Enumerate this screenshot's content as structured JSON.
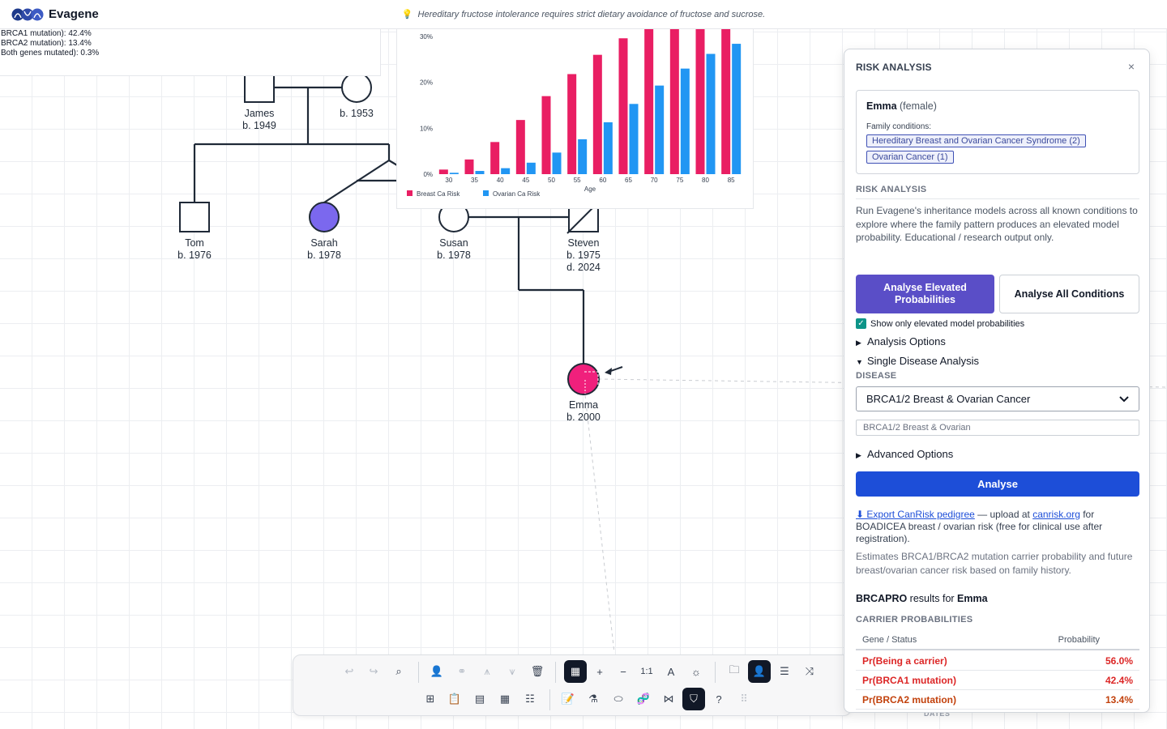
{
  "app": {
    "name": "Evagene",
    "tip": "Hereditary fructose intolerance requires strict dietary avoidance of fructose and sucrose.",
    "tip_icon": "lightbulb-icon"
  },
  "mini_card": {
    "lines": [
      "BRCA1 mutation): 42.4%",
      "BRCA2 mutation): 13.4%",
      "Both genes mutated): 0.3%"
    ]
  },
  "chart_data": {
    "type": "bar",
    "title": "",
    "xlabel": "Age",
    "ylabel": "",
    "categories": [
      "30",
      "35",
      "40",
      "45",
      "50",
      "55",
      "60",
      "65",
      "70",
      "75",
      "80",
      "85"
    ],
    "series": [
      {
        "name": "Breast Ca Risk",
        "color": "#e91e63",
        "values": [
          1.0,
          3.2,
          7.0,
          11.8,
          17.0,
          21.8,
          26.0,
          29.6,
          32.0,
          33.5,
          34.5,
          35.0
        ]
      },
      {
        "name": "Ovarian Ca Risk",
        "color": "#2196f3",
        "values": [
          0.3,
          0.7,
          1.3,
          2.5,
          4.7,
          7.6,
          11.3,
          15.3,
          19.3,
          23.0,
          26.2,
          28.4
        ]
      }
    ],
    "yticks": [
      "0%",
      "10%",
      "20%",
      "30%"
    ],
    "ylim": [
      0,
      30
    ],
    "legend_position": "bottom-left",
    "grid": false
  },
  "pedigree": {
    "people": [
      {
        "name": "James",
        "detail": [
          "b. 1949"
        ]
      },
      {
        "name": "",
        "detail": [
          "b. 1953"
        ]
      },
      {
        "name": "Tom",
        "detail": [
          "b. 1976"
        ]
      },
      {
        "name": "Sarah",
        "detail": [
          "b. 1978"
        ]
      },
      {
        "name": "Susan",
        "detail": [
          "b. 1978"
        ]
      },
      {
        "name": "Steven",
        "detail": [
          "b. 1975",
          "d. 2024"
        ]
      },
      {
        "name": "Emma",
        "detail": [
          "b. 2000"
        ]
      }
    ],
    "colors": {
      "affected_purple": "#7b68ee",
      "proband_pink": "#f0207c",
      "line": "#1f2937"
    }
  },
  "panel": {
    "title": "RISK ANALYSIS",
    "close": "×",
    "person": {
      "name": "Emma",
      "sex": "(female)"
    },
    "family_conditions_label": "Family conditions:",
    "conditions": [
      "Hereditary Breast and Ovarian Cancer Syndrome (2)",
      "Ovarian Cancer (1)"
    ],
    "section_title": "RISK ANALYSIS",
    "description": "Run Evagene's inheritance models across all known conditions to explore where the family pattern produces an elevated model probability. Educational / research output only.",
    "btn_elevated": "Analyse Elevated Probabilities",
    "btn_all": "Analyse All Conditions",
    "checkbox_label": "Show only elevated model probabilities",
    "analysis_options": "Analysis Options",
    "single_disease": "Single Disease Analysis",
    "disease_label": "DISEASE",
    "disease_value": "BRCA1/2 Breast & Ovarian Cancer",
    "disease_input": "BRCA1/2 Breast & Ovarian",
    "advanced_options": "Advanced Options",
    "analyse_btn": "Analyse",
    "export_link": "⬇ Export CanRisk pedigree",
    "export_mid": " — upload at ",
    "export_site": "canrisk.org",
    "export_tail": " for BOADICEA breast / ovarian risk (free for clinical use after registration).",
    "estimates": "Estimates BRCA1/BRCA2 mutation carrier probability and future breast/ovarian cancer risk based on family history.",
    "results_model": "BRCAPRO",
    "results_mid": " results for ",
    "results_person": "Emma",
    "carrier_header": "CARRIER PROBABILITIES",
    "table_headers": [
      "Gene / Status",
      "Probability"
    ],
    "rows": [
      {
        "label": "Pr(Being a carrier)",
        "value": "56.0%",
        "color": "#dc2626"
      },
      {
        "label": "Pr(BRCA1 mutation)",
        "value": "42.4%",
        "color": "#dc2626"
      },
      {
        "label": "Pr(BRCA2 mutation)",
        "value": "13.4%",
        "color": "#c2410c"
      }
    ]
  },
  "under_panel_label": "DATES",
  "toolbar": {
    "row1": [
      "undo-icon",
      "redo-icon",
      "search-icon",
      "add-person-icon",
      "link-icon",
      "add-children-icon",
      "add-parents-icon",
      "delete-icon",
      "grid-icon",
      "zoom-in-icon",
      "zoom-out-icon",
      "actual-size-icon",
      "text-size-icon",
      "brightness-icon",
      "folder-icon",
      "person-panel-icon",
      "sliders-icon",
      "shuffle-icon"
    ],
    "row2": [
      "tree-layout-icon",
      "clipboard-icon",
      "note-icon",
      "table-icon",
      "list-icon",
      "clipboard-add-icon",
      "flask-icon",
      "pill-icon",
      "dna-icon",
      "network-icon",
      "shield-icon",
      "help-icon",
      "drag-handle-icon"
    ],
    "zoom_label": "1:1"
  }
}
